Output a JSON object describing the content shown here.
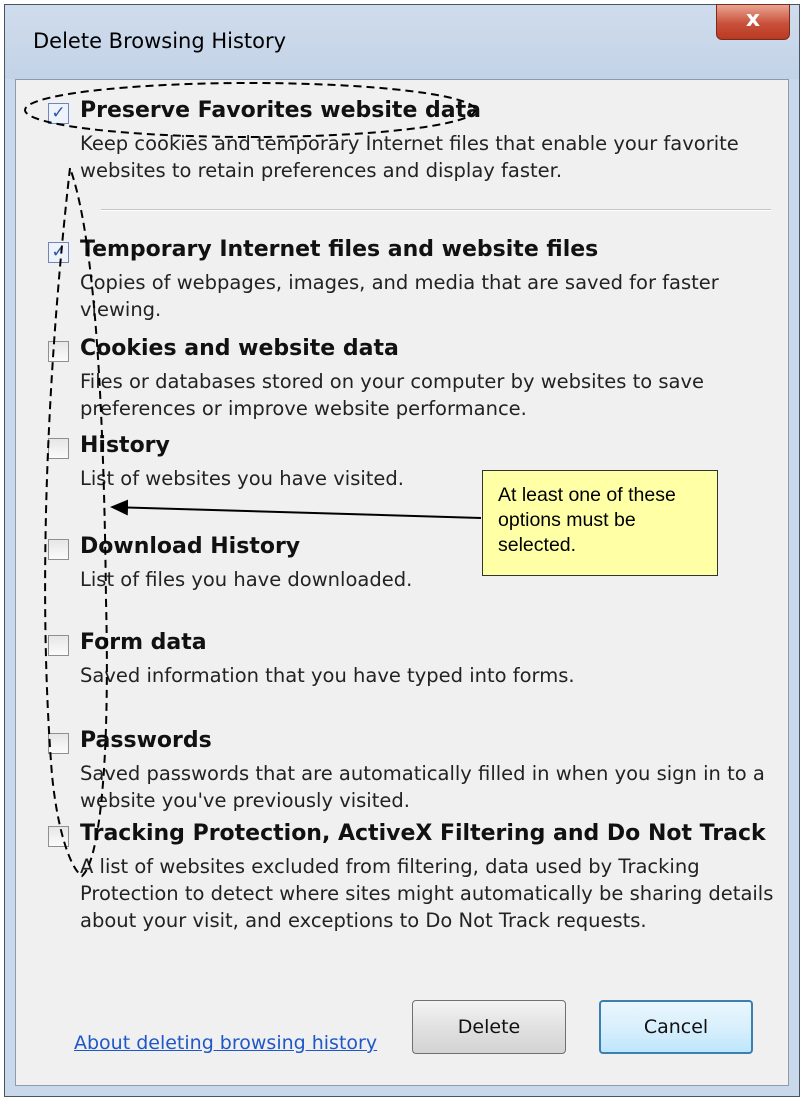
{
  "window": {
    "title": "Delete Browsing History",
    "close_label": "x"
  },
  "options": [
    {
      "id": "preserve-favorites",
      "label": "Preserve Favorites website data",
      "checked": true,
      "description": "Keep cookies and temporary Internet files that enable your favorite websites to retain preferences and display faster."
    },
    {
      "id": "temporary-internet-files",
      "label": "Temporary Internet files and website files",
      "checked": true,
      "description": "Copies of webpages, images, and media that are saved for faster viewing."
    },
    {
      "id": "cookies",
      "label": "Cookies and website data",
      "checked": false,
      "description": "Files or databases stored on your computer by websites to save preferences or improve website performance."
    },
    {
      "id": "history",
      "label": "History",
      "checked": false,
      "description": "List of websites you have visited."
    },
    {
      "id": "download-history",
      "label": "Download History",
      "checked": false,
      "description": "List of files you have downloaded."
    },
    {
      "id": "form-data",
      "label": "Form data",
      "checked": false,
      "description": "Saved information that you have typed into forms."
    },
    {
      "id": "passwords",
      "label": "Passwords",
      "checked": false,
      "description": "Saved passwords that are automatically filled in when you sign in to a website you've previously visited."
    },
    {
      "id": "tracking-protection",
      "label": "Tracking Protection, ActiveX Filtering and Do Not Track",
      "checked": false,
      "description": "A list of websites excluded from filtering, data used by Tracking Protection to detect where sites might automatically be sharing details about your visit, and exceptions to Do Not Track requests."
    }
  ],
  "footer": {
    "link_label": "About deleting browsing history",
    "delete_label": "Delete",
    "cancel_label": "Cancel"
  },
  "annotation": {
    "callout_text": "At least one of these options must be selected.",
    "callout_color": "#ffffa6"
  }
}
